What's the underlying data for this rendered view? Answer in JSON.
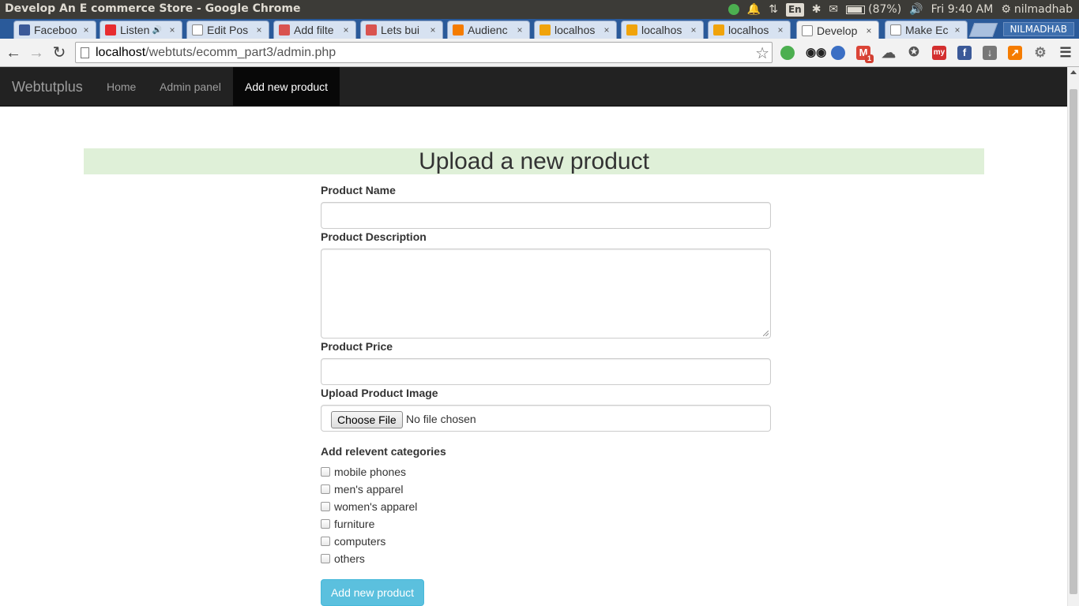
{
  "os_panel": {
    "window_title": "Develop An E commerce Store - Google Chrome",
    "battery": "(87%)",
    "clock": "Fri  9:40 AM",
    "user": "nilmadhab",
    "keyboard_layout": "En"
  },
  "browser": {
    "tabs": [
      {
        "label": "Faceboo",
        "icon": "facebook-icon",
        "color": "#3b5998"
      },
      {
        "label": "Listen",
        "icon": "gaana-icon",
        "color": "#e72c30",
        "audio": true
      },
      {
        "label": "Edit Pos",
        "icon": "page-icon",
        "color": "#ffffff"
      },
      {
        "label": "Add filte",
        "icon": "webtutplus-icon",
        "color": "#d9534f"
      },
      {
        "label": "Lets bui",
        "icon": "webtutplus-icon",
        "color": "#d9534f"
      },
      {
        "label": "Audienc",
        "icon": "analytics-icon",
        "color": "#f57c00"
      },
      {
        "label": "localhos",
        "icon": "phpmyadmin-icon",
        "color": "#f0a30a"
      },
      {
        "label": "localhos",
        "icon": "phpmyadmin-icon",
        "color": "#f0a30a"
      },
      {
        "label": "localhos",
        "icon": "phpmyadmin-icon",
        "color": "#f0a30a"
      },
      {
        "label": "Develop",
        "icon": "page-icon",
        "color": "#ffffff",
        "active": true
      },
      {
        "label": "Make Ec",
        "icon": "page-icon",
        "color": "#ffffff"
      }
    ],
    "profile_name": "NILMADHAB",
    "url_host": "localhost",
    "url_path": "/webtuts/ecomm_part3/admin.php",
    "mail_badge": "1"
  },
  "site": {
    "brand": "Webtutplus",
    "nav": [
      {
        "label": "Home"
      },
      {
        "label": "Admin panel"
      },
      {
        "label": "Add new product",
        "active": true
      }
    ]
  },
  "form": {
    "heading": "Upload a new product",
    "product_name_label": "Product Name",
    "product_name_value": "",
    "product_description_label": "Product Description",
    "product_description_value": "",
    "product_price_label": "Product Price",
    "product_price_value": "",
    "upload_image_label": "Upload Product Image",
    "choose_file_label": "Choose File",
    "file_status": "No file chosen",
    "categories_label": "Add relevent categories",
    "categories": [
      {
        "label": "mobile phones",
        "checked": false
      },
      {
        "label": "men's apparel",
        "checked": false
      },
      {
        "label": "women's apparel",
        "checked": false
      },
      {
        "label": "furniture",
        "checked": false
      },
      {
        "label": "computers",
        "checked": false
      },
      {
        "label": "others",
        "checked": false
      }
    ],
    "submit_label": "Add new product"
  },
  "colors": {
    "navbar_bg": "#222222",
    "heading_bg": "#dff0d8",
    "submit_bg": "#5bc0de"
  }
}
